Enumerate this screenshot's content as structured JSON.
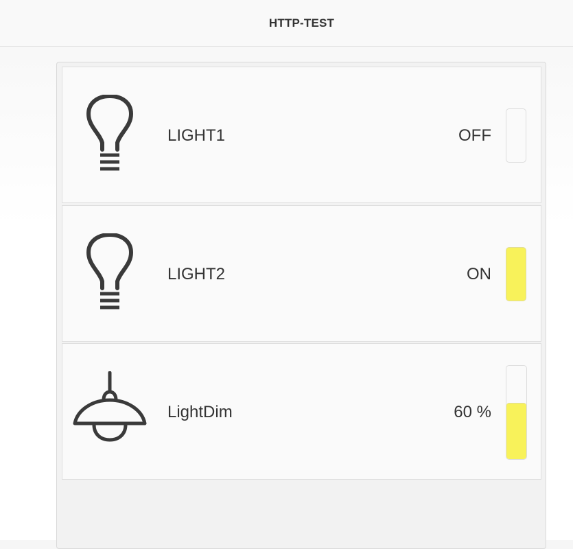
{
  "header": {
    "title": "HTTP-TEST"
  },
  "colors": {
    "accent": "#f8f25a",
    "text": "#333333"
  },
  "items": [
    {
      "icon": "light-bulb-icon",
      "label": "LIGHT1",
      "state": "OFF"
    },
    {
      "icon": "light-bulb-icon",
      "label": "LIGHT2",
      "state": "ON"
    },
    {
      "icon": "pendant-lamp-icon",
      "label": "LightDim",
      "state": "60 %",
      "level": 0.6
    }
  ]
}
